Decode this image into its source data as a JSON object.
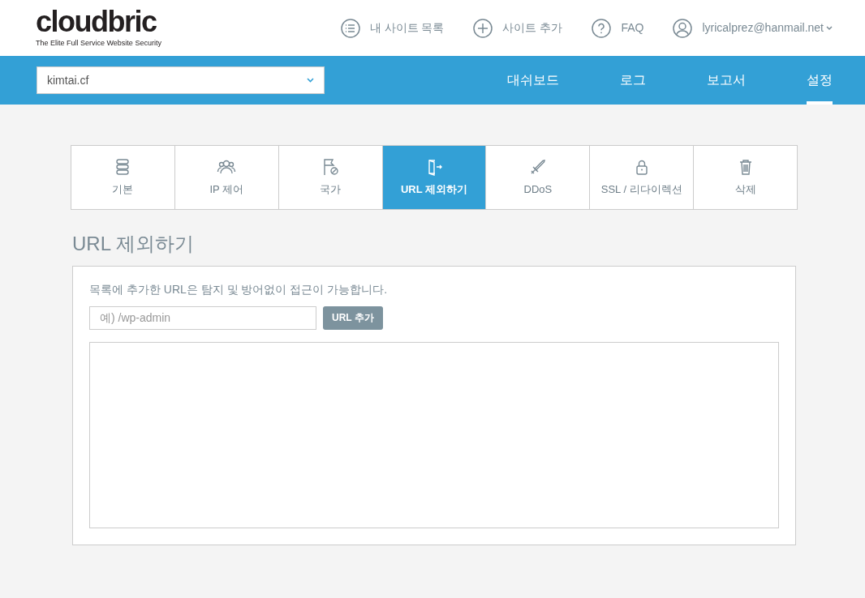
{
  "logo": {
    "name": "cloudbric",
    "tagline": "The Elite Full Service Website Security"
  },
  "top_links": [
    {
      "label": "내 사이트 목록"
    },
    {
      "label": "사이트 추가"
    },
    {
      "label": "FAQ"
    },
    {
      "label": "lyricalprez@hanmail.net",
      "dropdown": true
    }
  ],
  "site_select": {
    "value": "kimtai.cf"
  },
  "main_nav": [
    {
      "label": "대쉬보드",
      "selected": false
    },
    {
      "label": "로그",
      "selected": false
    },
    {
      "label": "보고서",
      "selected": false
    },
    {
      "label": "설정",
      "selected": true
    }
  ],
  "settings_tabs": [
    {
      "label": "기본",
      "selected": false
    },
    {
      "label": "IP 제어",
      "selected": false
    },
    {
      "label": "국가",
      "selected": false
    },
    {
      "label": "URL 제외하기",
      "selected": true
    },
    {
      "label": "DDoS",
      "selected": false
    },
    {
      "label": "SSL / 리다이렉션",
      "selected": false
    },
    {
      "label": "삭제",
      "selected": false
    }
  ],
  "section_title": "URL 제외하기",
  "panel": {
    "description": "목록에 추가한 URL은 탐지 및 방어없이 접근이 가능합니다.",
    "url_input": {
      "placeholder": "예) /wp-admin"
    },
    "add_button": "URL 추가"
  }
}
